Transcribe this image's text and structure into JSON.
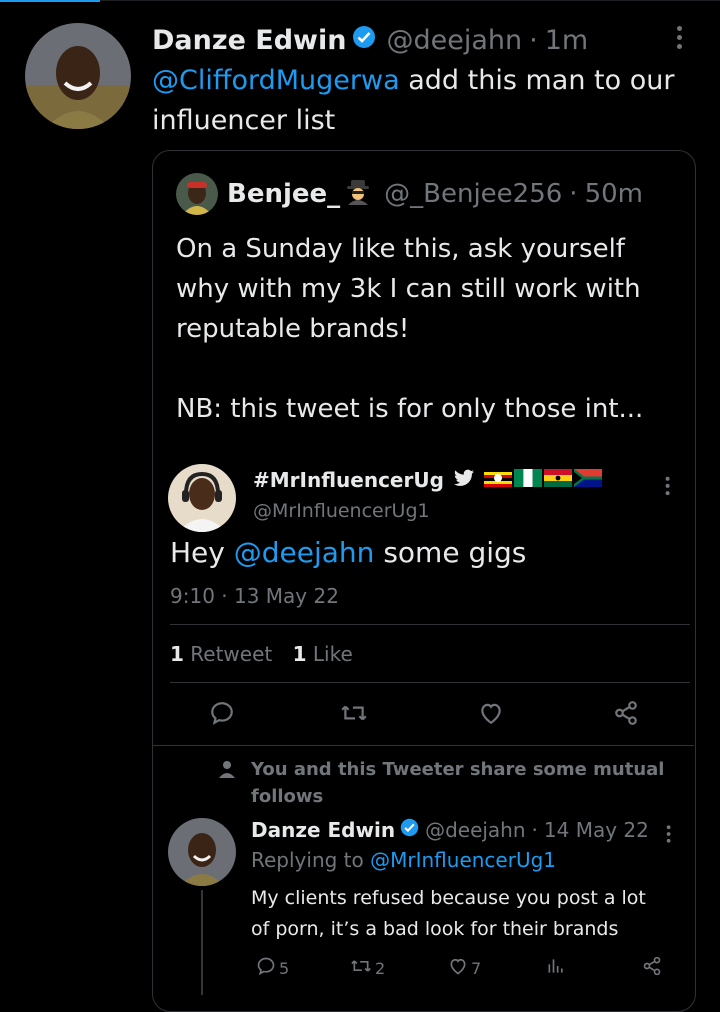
{
  "main_tweet": {
    "author_name": "Danze Edwin",
    "handle": "@deejahn",
    "separator": "·",
    "time": "1m",
    "mention": "@CliffordMugerwa",
    "text_line1": " add this man to our",
    "text_line2": "influencer list"
  },
  "quoted_tweet": {
    "author_name": "Benjee_",
    "handle": "@_Benjee256",
    "separator": "·",
    "time": "50m",
    "line1": "On a Sunday like this, ask yourself",
    "line2": "why with my 3k I can still work with",
    "line3": "reputable brands!",
    "line4": "NB: this tweet is for only those int..."
  },
  "embedded_tweet": {
    "author_name": "#MrInfluencerUg",
    "handle": "@MrInfluencerUg1",
    "text_prefix": "Hey ",
    "mention": "@deejahn",
    "text_suffix": " some gigs",
    "timestamp": "9:10 · 13 May 22",
    "retweet_count": "1",
    "retweet_label": " Retweet",
    "like_count": "1",
    "like_label": " Like"
  },
  "mutual_notice": {
    "line1": "You and this Tweeter share some mutual",
    "line2": "follows"
  },
  "reply_tweet": {
    "author_name": "Danze Edwin",
    "handle": "@deejahn",
    "separator": "·",
    "date": "14 May 22",
    "replying_prefix": "Replying to ",
    "replying_to": "@MrInfluencerUg1",
    "text_line1": "My clients refused because you post a lot",
    "text_line2": "of porn, it’s a bad look for their brands",
    "reply_count": "5",
    "retweet_count": "2",
    "like_count": "7"
  },
  "colors": {
    "background": "#000000",
    "primary_text": "#e7e9ea",
    "secondary_text": "#71767b",
    "accent": "#1d9bf0",
    "border": "#2f3336"
  },
  "icons": [
    "verified-badge-icon",
    "spy-emoji-icon",
    "twitter-bird-icon",
    "uganda-flag-icon",
    "nigeria-flag-icon",
    "ghana-flag-icon",
    "south-africa-flag-icon",
    "more-options-icon",
    "reply-icon",
    "retweet-icon",
    "like-icon",
    "share-icon",
    "person-icon",
    "analytics-icon"
  ]
}
